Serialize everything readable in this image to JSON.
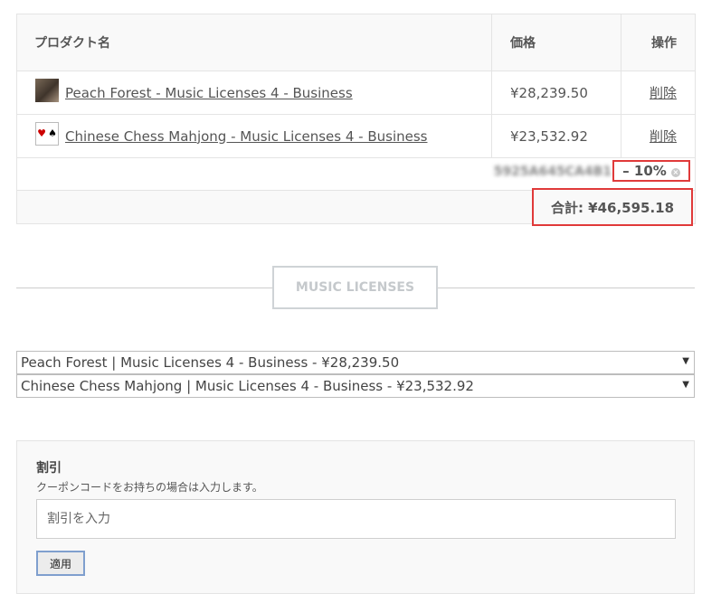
{
  "cart": {
    "headers": {
      "name": "プロダクト名",
      "price": "価格",
      "action": "操作"
    },
    "items": [
      {
        "name": "Peach Forest - Music Licenses 4 - Business",
        "price": "¥28,239.50",
        "remove": "削除",
        "thumb_icon": "album-art-icon"
      },
      {
        "name": "Chinese Chess Mahjong - Music Licenses 4 - Business",
        "price": "¥23,532.92",
        "remove": "削除",
        "thumb_icon": "playing-cards-icon"
      }
    ],
    "discount": {
      "code": "5925A645CA4B1",
      "amount": "– 10%"
    },
    "total": "合計: ¥46,595.18",
    "highlight_color": "#e03a3a"
  },
  "section": {
    "title": "MUSIC LICENSES"
  },
  "selects": [
    "Peach Forest | Music Licenses 4 - Business - ¥28,239.50",
    "Chinese Chess Mahjong | Music Licenses 4 - Business - ¥23,532.92"
  ],
  "coupon": {
    "title": "割引",
    "help": "クーポンコードをお持ちの場合は入力します。",
    "placeholder": "割引を入力",
    "apply_label": "適用"
  }
}
